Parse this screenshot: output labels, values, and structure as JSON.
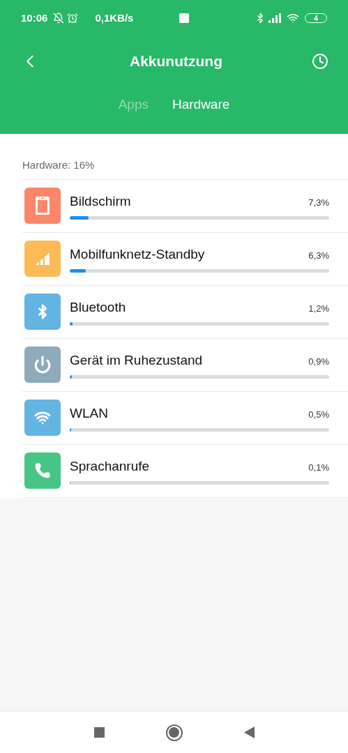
{
  "status_bar": {
    "time": "10:06",
    "speed": "0,1KB/s",
    "battery": "4"
  },
  "header": {
    "title": "Akkunutzung"
  },
  "tabs": [
    {
      "label": "Apps",
      "selected": false
    },
    {
      "label": "Hardware",
      "selected": true
    }
  ],
  "summary": "Hardware: 16%",
  "items": [
    {
      "name": "Bildschirm",
      "reading": "7,3%",
      "level": 0.073,
      "kind": "screen",
      "color": "#fc866a"
    },
    {
      "name": "Mobilfunknetz-Standby",
      "reading": "6,3%",
      "level": 0.063,
      "kind": "signal",
      "color": "#fdbb55"
    },
    {
      "name": "Bluetooth",
      "reading": "1,2%",
      "level": 0.012,
      "kind": "bluetooth",
      "color": "#62b4e2"
    },
    {
      "name": "Gerät im Ruhezustand",
      "reading": "0,9%",
      "level": 0.009,
      "kind": "power",
      "color": "#8eaabb"
    },
    {
      "name": "WLAN",
      "reading": "0,5%",
      "level": 0.005,
      "kind": "wifi",
      "color": "#62b4e2"
    },
    {
      "name": "Sprachanrufe",
      "reading": "0,1%",
      "level": 0.001,
      "kind": "phone",
      "color": "#47c585"
    }
  ]
}
